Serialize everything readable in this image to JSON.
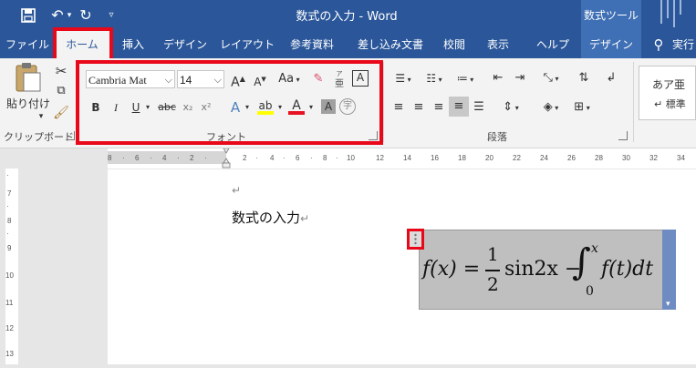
{
  "window": {
    "title": "数式の入力 - Word",
    "context_tab_header": "数式ツール"
  },
  "tabs": [
    "ファイル",
    "ホーム",
    "挿入",
    "デザイン",
    "レイアウト",
    "参考資料",
    "差し込み文書",
    "校閲",
    "表示",
    "ヘルプ",
    "デザイン"
  ],
  "tell_me": "実行",
  "ribbon": {
    "clipboard": {
      "paste_label": "貼り付け",
      "group_label": "クリップボード"
    },
    "font": {
      "font_name": "Cambria Mat",
      "font_size": "14",
      "case_label": "Aa",
      "group_label": "フォント",
      "bold": "B",
      "italic": "I",
      "underline": "U",
      "strike": "abc",
      "subscript": "x₂",
      "superscript": "x²",
      "clear_a": "A",
      "text_effect": "A",
      "font_color": "A",
      "shade_a": "A",
      "enclose": "字",
      "border_a": "A",
      "phonetic": "亜"
    },
    "paragraph": {
      "group_label": "段落"
    },
    "styles": {
      "style1": "あア亜",
      "style2": "↵ 標準"
    }
  },
  "document": {
    "body_text": "数式の入力",
    "equation": {
      "lhs": "f(x) = ",
      "numerator": "1",
      "denominator": "2",
      "mid": "sin2x − ",
      "integral": "∫",
      "upper": "x",
      "lower": "0",
      "rhs": "f(t)dt"
    }
  },
  "colors": {
    "accent": "#2b579a",
    "highlight_box": "#e8081a"
  }
}
